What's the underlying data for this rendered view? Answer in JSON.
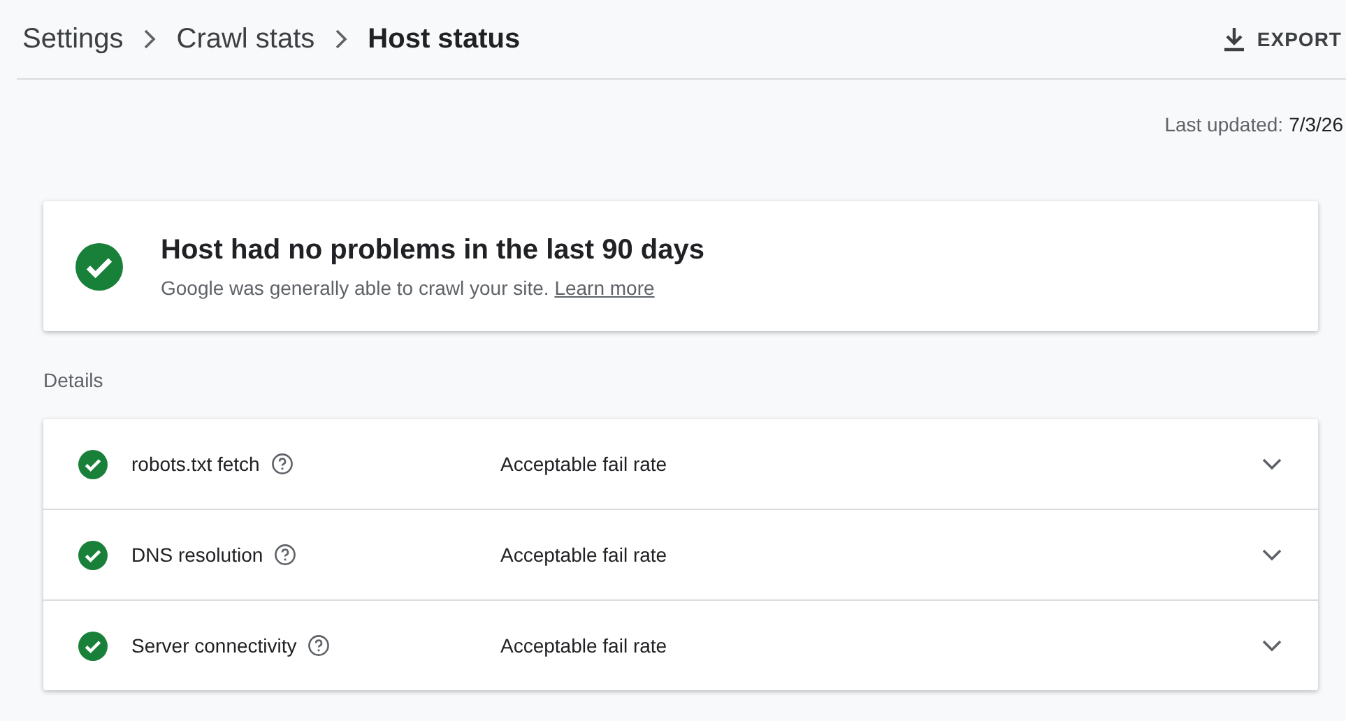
{
  "breadcrumbs": [
    {
      "label": "Settings",
      "current": false
    },
    {
      "label": "Crawl stats",
      "current": false
    },
    {
      "label": "Host status",
      "current": true
    }
  ],
  "export_button": {
    "label": "EXPORT"
  },
  "last_updated": {
    "label": "Last updated:",
    "value": "7/3/26"
  },
  "summary": {
    "title": "Host had no problems in the last 90 days",
    "text": "Google was generally able to crawl your site.",
    "link": "Learn more"
  },
  "details": {
    "heading": "Details",
    "rows": [
      {
        "name": "robots.txt fetch",
        "result": "Acceptable fail rate",
        "expanded": false
      },
      {
        "name": "DNS resolution",
        "result": "Acceptable fail rate",
        "expanded": false
      },
      {
        "name": "Server connectivity",
        "result": "Acceptable fail rate",
        "expanded": false
      }
    ]
  }
}
